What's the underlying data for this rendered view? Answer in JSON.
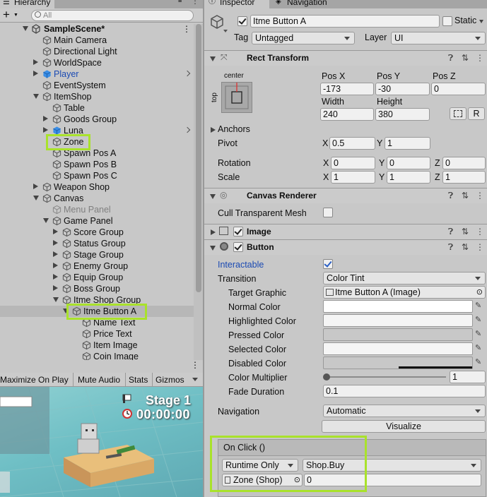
{
  "hierarchy": {
    "tab_label": "Hierarchy",
    "search_placeholder": "All",
    "scene_name": "SampleScene*",
    "items": [
      {
        "label": "Main Camera"
      },
      {
        "label": "Directional Light"
      },
      {
        "label": "WorldSpace"
      },
      {
        "label": "Player"
      },
      {
        "label": "EventSystem"
      },
      {
        "label": "ItemShop"
      },
      {
        "label": "Table"
      },
      {
        "label": "Goods Group"
      },
      {
        "label": "Luna"
      },
      {
        "label": "Zone"
      },
      {
        "label": "Spawn Pos A"
      },
      {
        "label": "Spawn Pos B"
      },
      {
        "label": "Spawn Pos C"
      },
      {
        "label": "Weapon Shop"
      },
      {
        "label": "Canvas"
      },
      {
        "label": "Menu Panel"
      },
      {
        "label": "Game Panel"
      },
      {
        "label": "Score Group"
      },
      {
        "label": "Status Group"
      },
      {
        "label": "Stage Group"
      },
      {
        "label": "Enemy Group"
      },
      {
        "label": "Equip Group"
      },
      {
        "label": "Boss Group"
      },
      {
        "label": "Itme Shop Group"
      },
      {
        "label": "Itme Button A"
      },
      {
        "label": "Name Text"
      },
      {
        "label": "Price Text"
      },
      {
        "label": "Item Image"
      },
      {
        "label": "Coin Image"
      }
    ]
  },
  "game": {
    "buttons": [
      "Maximize On Play",
      "Mute Audio",
      "Stats",
      "Gizmos"
    ],
    "stage_text": "Stage 1",
    "timer_text": "00:00:00"
  },
  "inspector": {
    "tabs": [
      "Inspector",
      "Navigation"
    ],
    "object_name": "Itme Button A",
    "static_label": "Static",
    "tag_label": "Tag",
    "tag_value": "Untagged",
    "layer_label": "Layer",
    "layer_value": "UI",
    "rect_transform": {
      "title": "Rect Transform",
      "anchor_h": "center",
      "anchor_v": "top",
      "pos_x_label": "Pos X",
      "pos_x": "-173",
      "pos_y_label": "Pos Y",
      "pos_y": "-30",
      "pos_z_label": "Pos Z",
      "pos_z": "0",
      "width_label": "Width",
      "width": "240",
      "height_label": "Height",
      "height": "380",
      "r_label": "R",
      "anchors_label": "Anchors",
      "pivot_label": "Pivot",
      "pivot_x": "0.5",
      "pivot_y": "1",
      "rotation_label": "Rotation",
      "rot_x": "0",
      "rot_y": "0",
      "rot_z": "0",
      "scale_label": "Scale",
      "scale_x": "1",
      "scale_y": "1",
      "scale_z": "1",
      "x": "X",
      "y": "Y",
      "z": "Z"
    },
    "canvas_renderer": {
      "title": "Canvas Renderer",
      "cull_label": "Cull Transparent Mesh"
    },
    "image": {
      "title": "Image"
    },
    "button": {
      "title": "Button",
      "interactable_label": "Interactable",
      "transition_label": "Transition",
      "transition_value": "Color Tint",
      "target_graphic_label": "Target Graphic",
      "target_graphic_value": "Itme Button A (Image)",
      "normal_color_label": "Normal Color",
      "highlighted_color_label": "Highlighted Color",
      "pressed_color_label": "Pressed Color",
      "selected_color_label": "Selected Color",
      "disabled_color_label": "Disabled Color",
      "color_multiplier_label": "Color Multiplier",
      "color_multiplier_value": "1",
      "fade_duration_label": "Fade Duration",
      "fade_duration_value": "0.1",
      "navigation_label": "Navigation",
      "navigation_value": "Automatic",
      "visualize_label": "Visualize",
      "onclick_label": "On Click ()",
      "runtime_value": "Runtime Only",
      "function_value": "Shop.Buy",
      "target_object": "Zone (Shop)",
      "argument_value": "0"
    }
  },
  "colors": {
    "highlight": "#a9e22b",
    "panel_bg": "#c8c8c8",
    "selection_bg": "#b7b7b7",
    "link_blue": "#1a4ab3"
  }
}
